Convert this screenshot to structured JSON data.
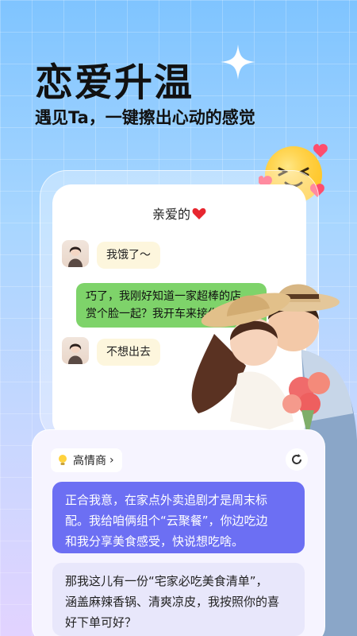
{
  "hero": {
    "title": "恋爱升温",
    "subtitle": "遇见Ta，一键擦出心动的感觉"
  },
  "chat": {
    "title": "亲爱的",
    "title_icon": "red-heart-icon",
    "messages": [
      {
        "from": "her",
        "text": "我饿了～"
      },
      {
        "from": "me",
        "line1": "巧了，我刚好知道一家超棒的店，",
        "line2": "赏个脸一起？我开车来接你"
      },
      {
        "from": "her",
        "text": "不想出去"
      }
    ]
  },
  "assistant": {
    "mode_label": "高情商",
    "mode_icon": "lightbulb-icon",
    "refresh_icon": "refresh-icon",
    "replies": [
      {
        "line1": "正合我意，在家点外卖追剧才是周末标",
        "line2": "配。我给咱俩组个“云聚餐”，你边吃边",
        "line3": "和我分享美食感受，快说想吃啥。"
      },
      {
        "line1": "那我这儿有一份“宅家必吃美食清单”，",
        "line2": "涵盖麻辣香锅、清爽凉皮，我按照你的喜",
        "line3": "好下单可好？"
      }
    ]
  },
  "colors": {
    "accent": "#6c6ff3",
    "out_bubble": "#7ed36a",
    "in_bubble": "#fdf6dd"
  }
}
